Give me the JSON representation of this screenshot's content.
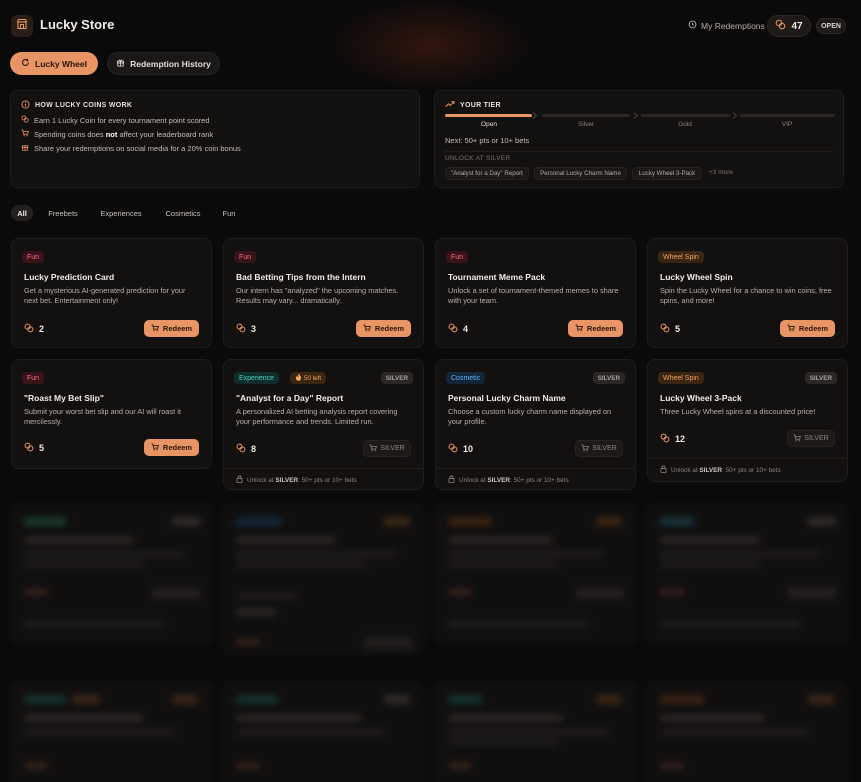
{
  "header": {
    "title": "Lucky Store",
    "redemptions_link": "My Redemptions",
    "coin_count": "47",
    "status": "OPEN"
  },
  "tabs": [
    {
      "label": "Lucky Wheel",
      "active": true
    },
    {
      "label": "Redemption History",
      "active": false
    }
  ],
  "info": {
    "title": "HOW LUCKY COINS WORK",
    "line1": "Earn 1 Lucky Coin for every tournament point scored",
    "line2_pre": "Spending coins does ",
    "line2_bold": "not",
    "line2_post": " affect your leaderboard rank",
    "line3": "Share your redemptions on social media for a 20% coin bonus"
  },
  "tier": {
    "title": "YOUR TIER",
    "levels": [
      "Open",
      "Silver",
      "Gold",
      "VIP"
    ],
    "next": "Next: 50+ pts or 10+ bets",
    "unlock_label": "UNLOCK AT SILVER",
    "chips": [
      "\"Analyst for a Day\" Report",
      "Personal Lucky Charm Name",
      "Lucky Wheel 3-Pack"
    ],
    "more": "+3 more"
  },
  "filters": [
    "All",
    "Freebets",
    "Experiences",
    "Cosmetics",
    "Fun"
  ],
  "common": {
    "redeem": "Redeem",
    "silver": "SILVER",
    "unlock_pre": "Unlock at ",
    "unlock_bold": "SILVER",
    "unlock_post": ": 50+ pts or 10+ bets"
  },
  "cards": [
    {
      "badge": "Fun",
      "title": "Lucky Prediction Card",
      "desc": "Get a mysterious AI-generated prediction for your next bet. Entertainment only!",
      "price": "2"
    },
    {
      "badge": "Fun",
      "title": "Bad Betting Tips from the Intern",
      "desc": "Our intern has \"analyzed\" the upcoming matches. Results may vary... dramatically.",
      "price": "3"
    },
    {
      "badge": "Fun",
      "title": "Tournament Meme Pack",
      "desc": "Unlock a set of tournament-themed memes to share with your team.",
      "price": "4"
    },
    {
      "badge": "Wheel Spin",
      "title": "Lucky Wheel Spin",
      "desc": "Spin the Lucky Wheel for a chance to win coins, free spins, and more!",
      "price": "5"
    },
    {
      "badge": "Fun",
      "title": "\"Roast My Bet Slip\"",
      "desc": "Submit your worst bet slip and our AI will roast it mercilessly.",
      "price": "5"
    },
    {
      "badge": "Experience",
      "left": "50 left",
      "title": "\"Analyst for a Day\" Report",
      "desc": "A personalized AI betting analysis report covering your performance and trends. Limited run.",
      "price": "8"
    },
    {
      "badge": "Cosmetic",
      "title": "Personal Lucky Charm Name",
      "desc": "Choose a custom lucky charm name displayed on your profile.",
      "price": "10"
    },
    {
      "badge": "Wheel Spin",
      "title": "Lucky Wheel 3-Pack",
      "desc": "Three Lucky Wheel spins at a discounted price!",
      "price": "12"
    }
  ],
  "colors": {
    "accent": "#e99464",
    "fun": "#f5727f",
    "wheel": "#f1a562",
    "experience": "#4fd3c0",
    "cosmetic": "#5fb3f2"
  }
}
